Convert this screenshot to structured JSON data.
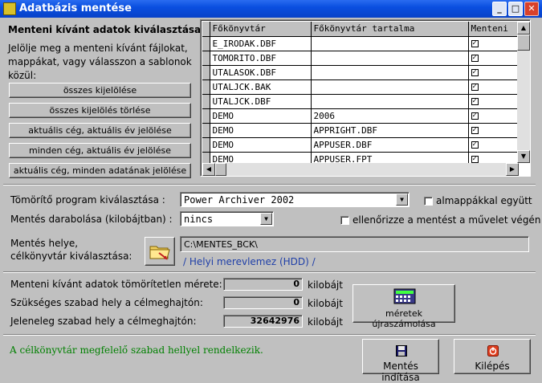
{
  "window": {
    "title": "Adatbázis mentése",
    "min_label": "_",
    "max_label": "□",
    "close_label": "✕"
  },
  "left_panel": {
    "heading": "Menteni kívánt adatok kiválasztása:",
    "instructions": "Jelölje meg a menteni kívánt fájlokat, mappákat, vagy válasszon a sablonok közül:",
    "buttons": [
      "összes kijelölése",
      "összes kijelölés törlése",
      "aktuális cég, aktuális év jelölése",
      "minden cég, aktuális év jelölése",
      "aktuális cég, minden adatának jelölése"
    ]
  },
  "grid": {
    "columns": [
      "Főkönyvtár",
      "Főkönyvtár tartalma",
      "Menteni"
    ],
    "rows": [
      {
        "dir": "E_IRODAK.DBF",
        "content": "",
        "checked": true
      },
      {
        "dir": "TOMORITO.DBF",
        "content": "",
        "checked": true
      },
      {
        "dir": "UTALASOK.DBF",
        "content": "",
        "checked": true
      },
      {
        "dir": "UTALJCK.BAK",
        "content": "",
        "checked": true
      },
      {
        "dir": "UTALJCK.DBF",
        "content": "",
        "checked": true
      },
      {
        "dir": "DEMO",
        "content": "2006",
        "checked": true
      },
      {
        "dir": "DEMO",
        "content": "APPRIGHT.DBF",
        "checked": true
      },
      {
        "dir": "DEMO",
        "content": "APPUSER.DBF",
        "checked": true
      },
      {
        "dir": "DEMO",
        "content": "APPUSER.FPT",
        "checked": true
      }
    ]
  },
  "options": {
    "compressor_label": "Tömörítő program kiválasztása :",
    "compressor_value": "Power Archiver 2002",
    "subfolders_label": "almappákkal együtt",
    "subfolders_checked": false,
    "split_label": "Mentés darabolása (kilobájtban) :",
    "split_value": "nincs",
    "verify_label": "ellenőrizze a mentést a művelet végén",
    "verify_checked": false
  },
  "destination": {
    "label_line1": "Mentés helye,",
    "label_line2": "célkönyvtár kiválasztása:",
    "path": "C:\\MENTES_BCK\\",
    "drive_desc": "/ Helyi merevlemez (HDD) /"
  },
  "sizes": {
    "uncompressed_label": "Menteni kívánt adatok tömörítetlen mérete:",
    "uncompressed_value": "0",
    "required_label": "Szükséges szabad hely a célmeghajtón:",
    "required_value": "0",
    "available_label": "Jeleneleg szabad hely a célmeghajtón:",
    "available_value": "32642976",
    "unit": "kilobájt",
    "recalc_button": "méretek újraszámolása"
  },
  "status": {
    "message": "A célkönyvtár megfelelő szabad hellyel rendelkezik.",
    "color": "#008000"
  },
  "actions": {
    "start_button": "Mentés indítása",
    "exit_button": "Kilépés"
  }
}
